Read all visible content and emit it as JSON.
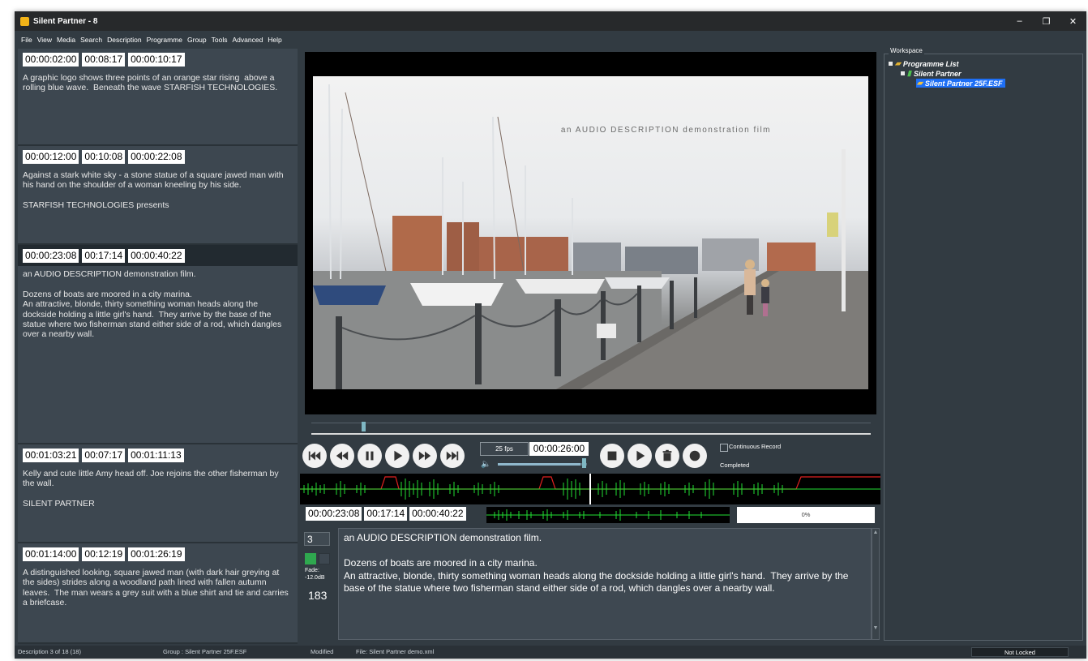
{
  "window": {
    "title": "Silent Partner - 8",
    "controls": {
      "minimize": "–",
      "maximize": "❐",
      "close": "✕"
    }
  },
  "menu": [
    "File",
    "View",
    "Media",
    "Search",
    "Description",
    "Programme",
    "Group",
    "Tools",
    "Advanced",
    "Help"
  ],
  "descriptions": [
    {
      "in": "00:00:02:00",
      "dur": "00:08:17",
      "out": "00:00:10:17",
      "text": "A graphic logo shows three points of an orange star rising  above a rolling blue wave.  Beneath the wave STARFISH TECHNOLOGIES."
    },
    {
      "in": "00:00:12:00",
      "dur": "00:10:08",
      "out": "00:00:22:08",
      "text": "Against a stark white sky - a stone statue of a square jawed man with his hand on the shoulder of a woman kneeling by his side.\n\nSTARFISH TECHNOLOGIES presents"
    },
    {
      "in": "00:00:23:08",
      "dur": "00:17:14",
      "out": "00:00:40:22",
      "text": "an AUDIO DESCRIPTION demonstration film.\n\nDozens of boats are moored in a city marina.\nAn attractive, blonde, thirty something woman heads along the dockside holding a little girl's hand.  They arrive by the base of the statue where two fisherman stand either side of a rod, which dangles over a nearby wall."
    },
    {
      "in": "00:01:03:21",
      "dur": "00:07:17",
      "out": "00:01:11:13",
      "text": "Kelly and cute little Amy head off. Joe rejoins the other fisherman by the wall.\n\nSILENT PARTNER"
    },
    {
      "in": "00:01:14:00",
      "dur": "00:12:19",
      "out": "00:01:26:19",
      "text": "A distinguished looking, square jawed man (with dark hair greying at the sides) strides along a woodland path lined with fallen autumn leaves.  The man wears a grey suit with a blue shirt and tie and carries a briefcase."
    }
  ],
  "video": {
    "caption": "an AUDIO DESCRIPTION demonstration film"
  },
  "player": {
    "fps": "25 fps",
    "current_time": "00:00:26:00",
    "continuous_record_label": "Continuous Record",
    "status": "Completed",
    "seek_position": 0.08,
    "volume": 0.93
  },
  "current": {
    "in": "00:00:23:08",
    "dur": "00:17:14",
    "out": "00:00:40:22",
    "progress": "0%",
    "number": "3",
    "fade_label": "Fade:",
    "fade_value": "-12.0dB",
    "count": "183",
    "text": "an AUDIO DESCRIPTION demonstration film.\n\nDozens of boats are moored in a city marina.\nAn attractive, blonde, thirty something woman heads along the dockside holding a little girl's hand.  They arrive by the base of the statue where two fisherman stand either side of a rod, which dangles over a nearby wall."
  },
  "workspace": {
    "title": "Workspace",
    "tree": {
      "root": "Programme List",
      "programme": "Silent Partner",
      "file": "Silent Partner 25F.ESF"
    }
  },
  "status": {
    "description": "Description 3 of 18 (18)",
    "group": "Group : Silent Partner 25F.ESF",
    "modified": "Modified",
    "file": "File: Silent Partner demo.xml",
    "lock": "Not Locked"
  },
  "colors": {
    "window_bg": "#323b42",
    "card_bg": "#3d4750",
    "waveform": "#22e033",
    "marker": "#e02020",
    "selection": "#1e6ff5",
    "led": "#2fa84f"
  }
}
